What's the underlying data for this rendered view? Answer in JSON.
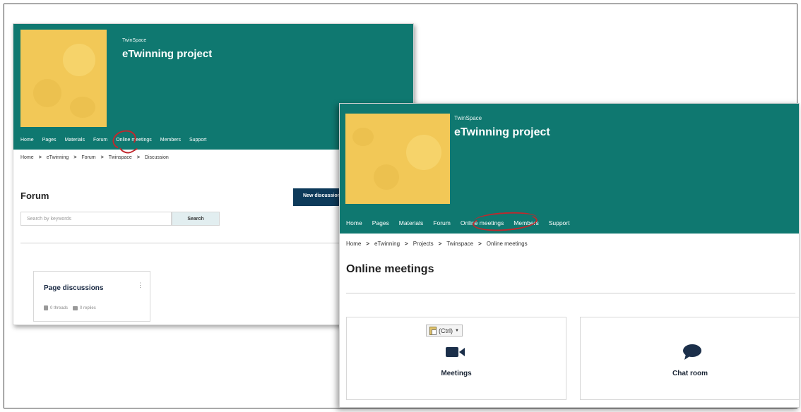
{
  "back": {
    "space_label": "TwinSpace",
    "project_title": "eTwinning project",
    "nav": [
      "Home",
      "Pages",
      "Materials",
      "Forum",
      "Online meetings",
      "Members",
      "Support"
    ],
    "breadcrumb": [
      "Home",
      "eTwinning",
      "Forum",
      "Twinspace",
      "Discussion"
    ],
    "page_title": "Forum",
    "new_discussion_label": "New discussion",
    "search_placeholder": "Search by keywords",
    "search_label": "Search",
    "card": {
      "title": "Page discussions",
      "threads": "0 threads",
      "replies": "0 replies"
    }
  },
  "front": {
    "space_label": "TwinSpace",
    "project_title": "eTwinning project",
    "nav": [
      "Home",
      "Pages",
      "Materials",
      "Forum",
      "Online meetings",
      "Members",
      "Support"
    ],
    "breadcrumb": [
      "Home",
      "eTwinning",
      "Projects",
      "Twinspace",
      "Online meetings"
    ],
    "page_title": "Online meetings",
    "paste_label": "(Ctrl)",
    "cards": [
      {
        "label": "Meetings",
        "icon": "video-camera-icon"
      },
      {
        "label": "Chat room",
        "icon": "chat-bubble-icon"
      }
    ]
  },
  "colors": {
    "banner": "#0f7870",
    "cover": "#f2c857",
    "highlight": "#c0282d",
    "dark_button": "#0d3a5a"
  }
}
